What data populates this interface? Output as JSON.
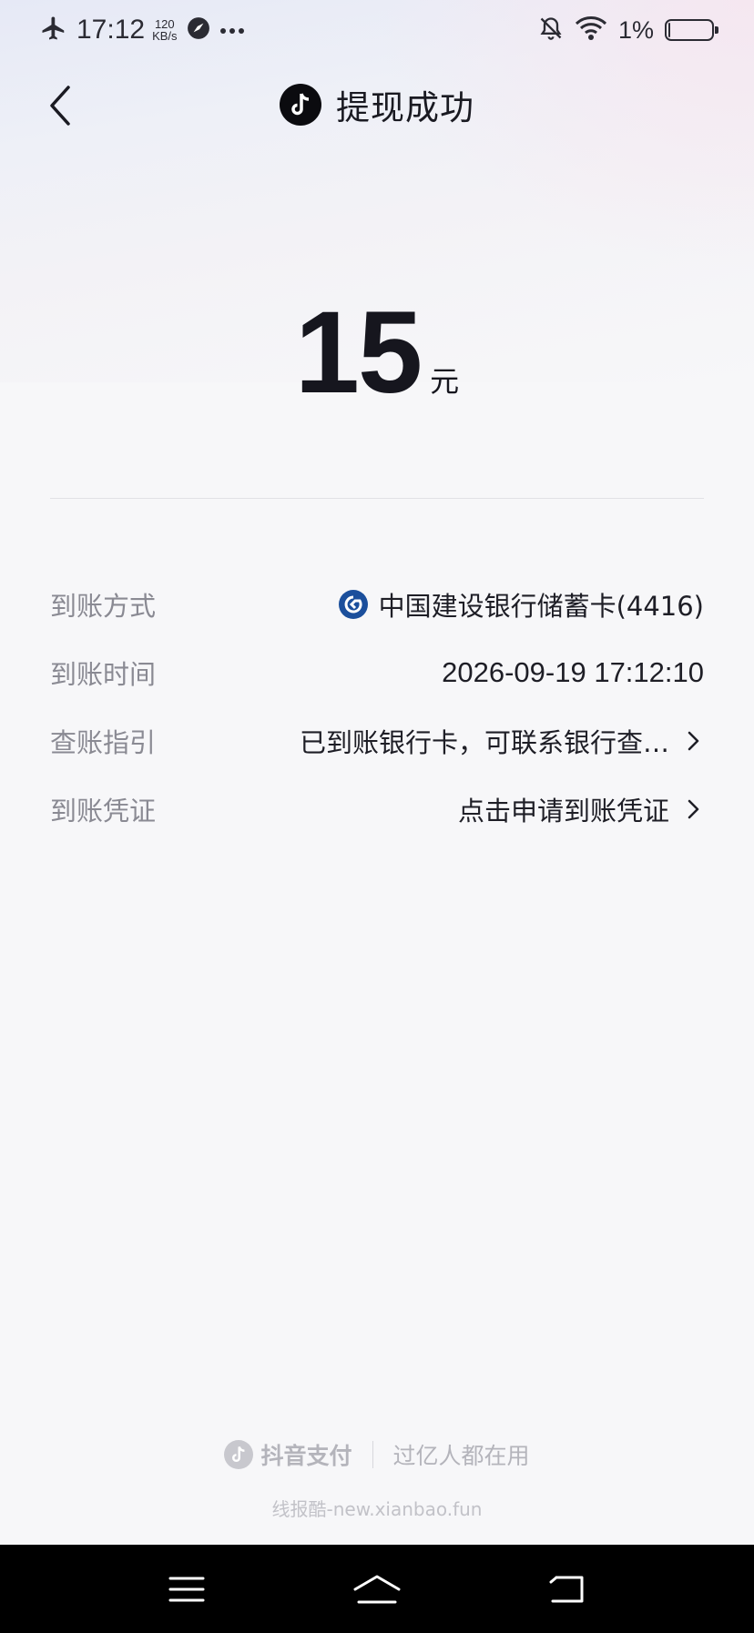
{
  "status_bar": {
    "time": "17:12",
    "speed_value": "120",
    "speed_unit": "KB/s",
    "battery_percent": "1%",
    "battery_level": 0.01
  },
  "header": {
    "title": "提现成功"
  },
  "amount": {
    "value": "15",
    "unit": "元"
  },
  "details": [
    {
      "label": "到账方式",
      "value": "中国建设银行储蓄卡(4416)"
    },
    {
      "label": "到账时间",
      "value": "2026-09-19 17:12:10"
    },
    {
      "label": "查账指引",
      "value": "已到账银行卡，可联系银行查…"
    },
    {
      "label": "到账凭证",
      "value": "点击申请到账凭证"
    }
  ],
  "footer": {
    "brand_name": "抖音支付",
    "slogan": "过亿人都在用",
    "watermark": "线报酷-new.xianbao.fun"
  },
  "colors": {
    "bank_blue": "#1b4f9c",
    "nav_bar": "#000000",
    "text_primary": "#1a1a22",
    "text_secondary": "#8a8a93"
  },
  "icons": {
    "status_left": [
      "airplane-icon",
      "speed-icon",
      "browser-icon",
      "more-dots-icon"
    ],
    "status_right": [
      "bell-muted-icon",
      "wifi-icon",
      "battery-icon"
    ],
    "nav": [
      "menu-icon",
      "home-icon",
      "back-nav-icon"
    ]
  }
}
